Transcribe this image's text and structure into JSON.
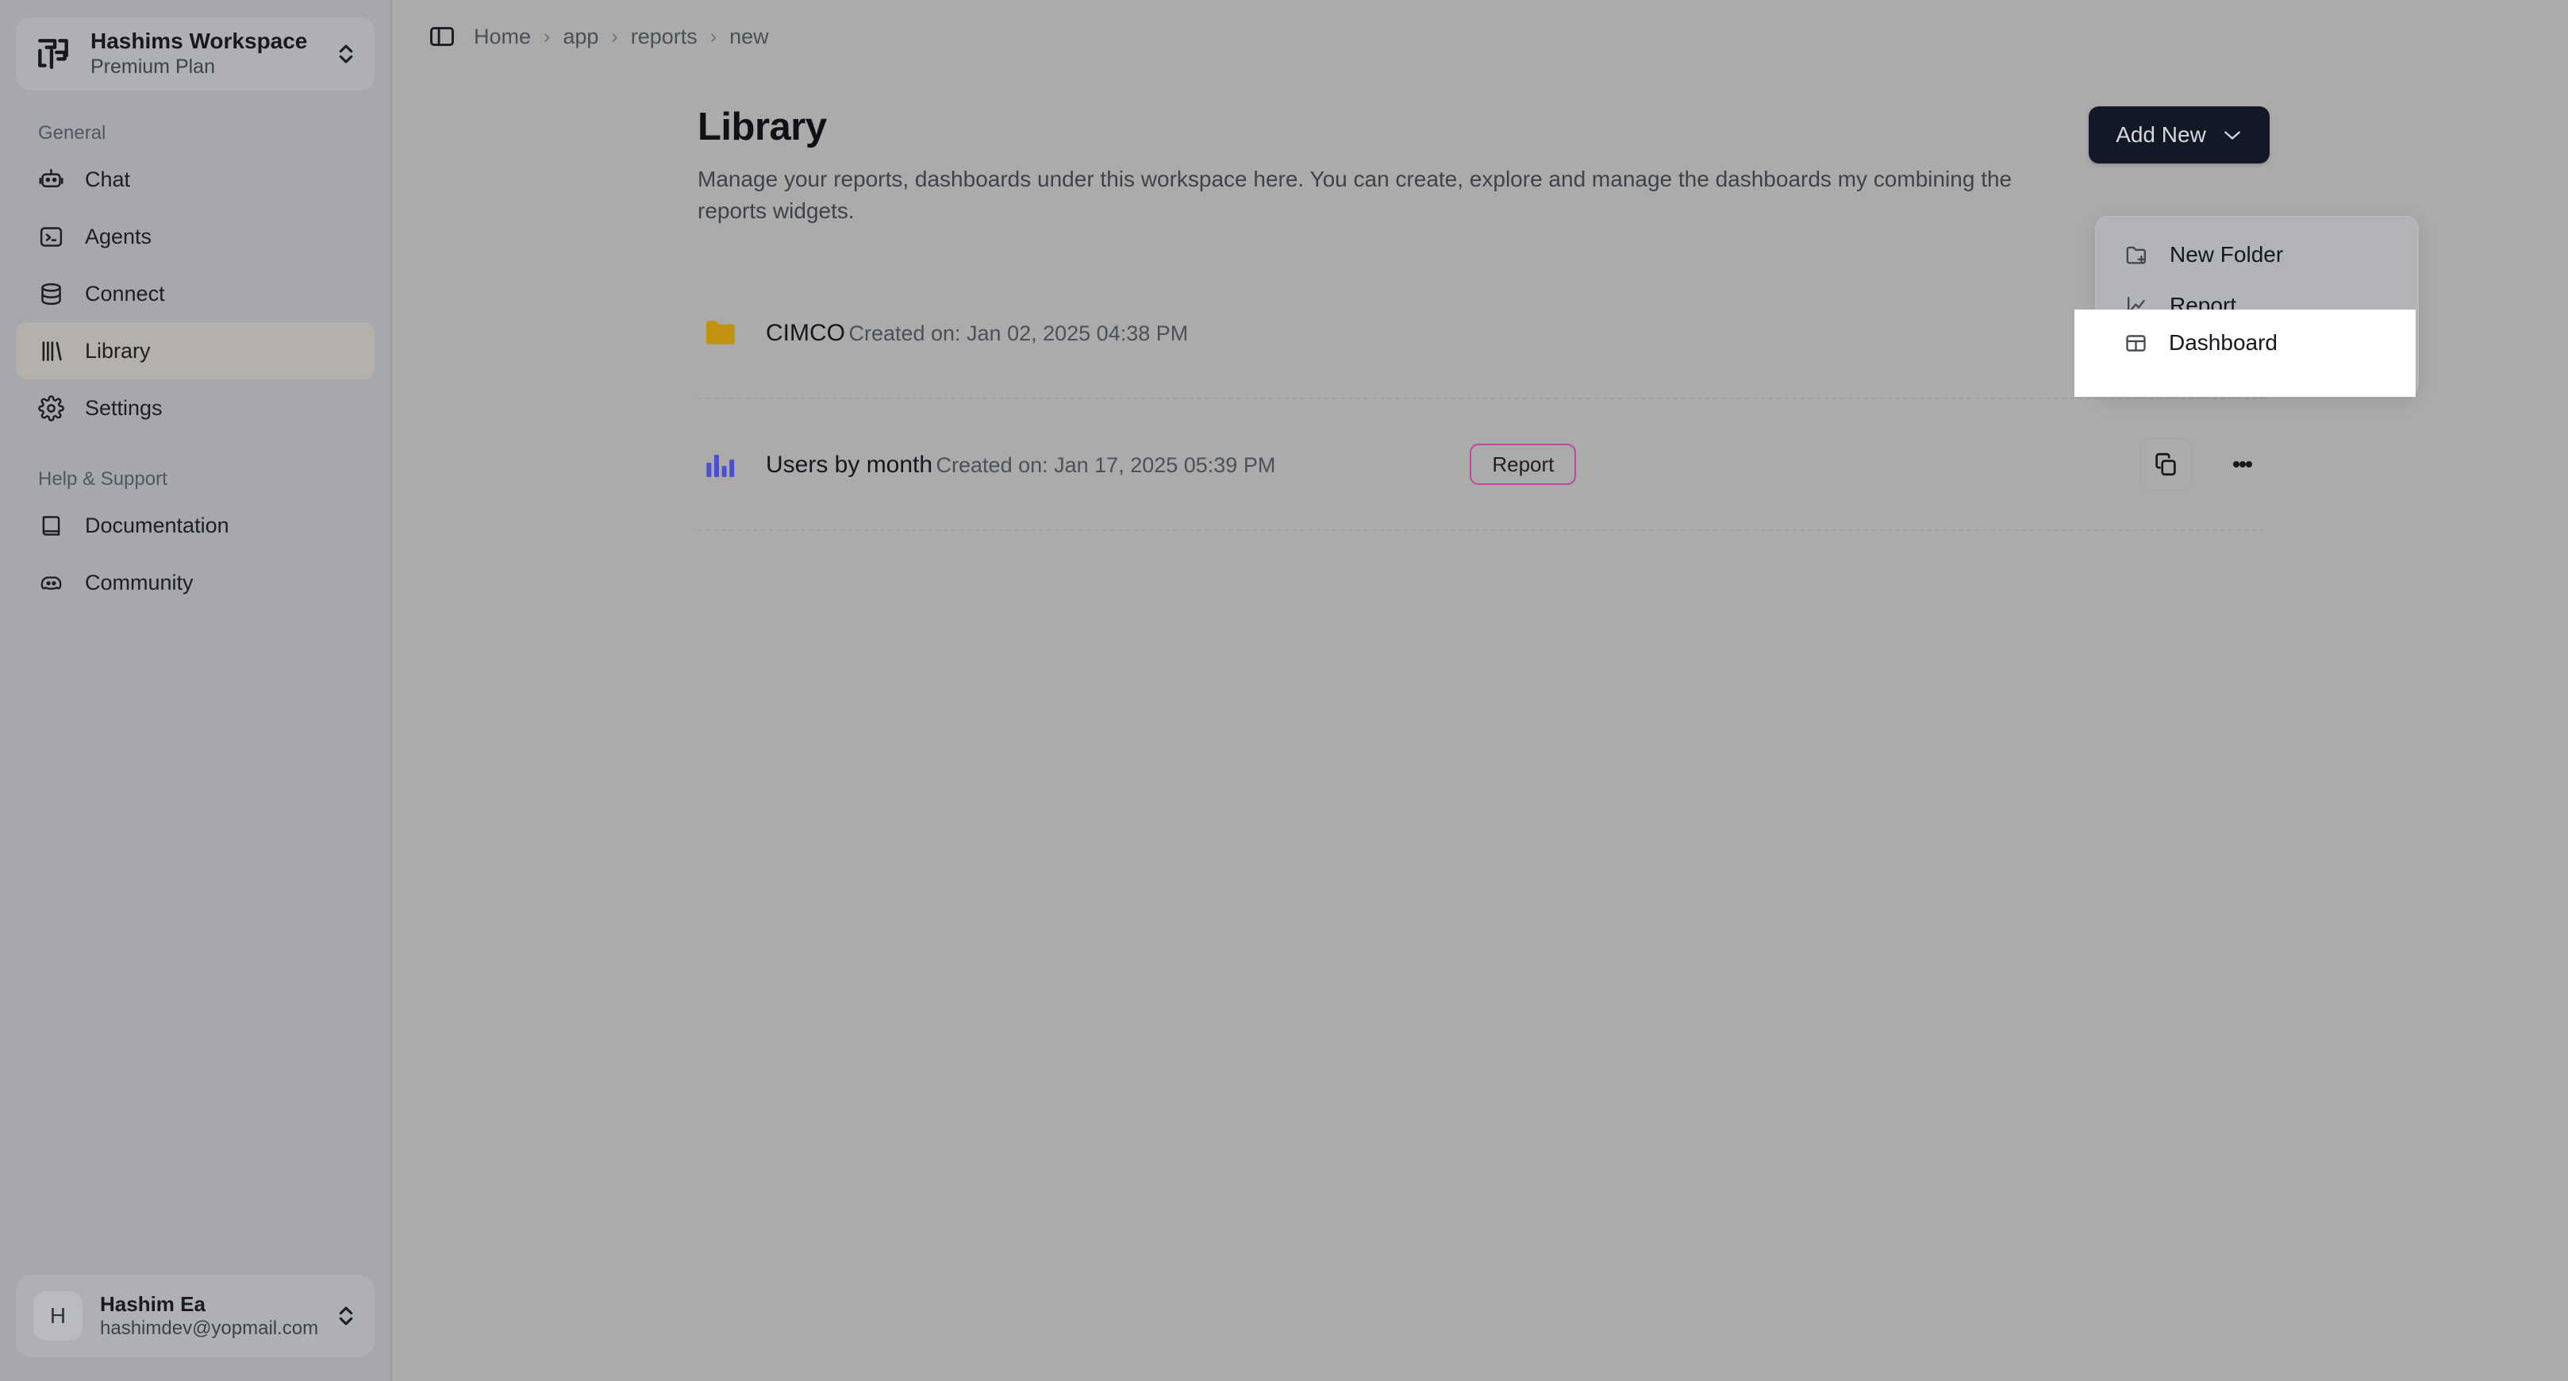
{
  "workspace": {
    "logo_icon": "workspace-logo-icon",
    "name": "Hashims Workspace",
    "plan": "Premium Plan",
    "switcher_icon": "chevron-up-down-icon"
  },
  "sidebar": {
    "sections": [
      {
        "label": "General",
        "items": [
          {
            "label": "Chat",
            "icon": "bot-icon",
            "active": false
          },
          {
            "label": "Agents",
            "icon": "terminal-square-icon",
            "active": false
          },
          {
            "label": "Connect",
            "icon": "database-icon",
            "active": false
          },
          {
            "label": "Library",
            "icon": "library-icon",
            "active": true
          },
          {
            "label": "Settings",
            "icon": "gear-icon",
            "active": false
          }
        ]
      },
      {
        "label": "Help & Support",
        "items": [
          {
            "label": "Documentation",
            "icon": "book-icon",
            "active": false
          },
          {
            "label": "Community",
            "icon": "discord-icon",
            "active": false
          }
        ]
      }
    ]
  },
  "user": {
    "initial": "H",
    "name": "Hashim Ea",
    "email": "hashimdev@yopmail.com",
    "switcher_icon": "chevron-up-down-icon"
  },
  "topbar": {
    "toggle_icon": "panel-left-icon",
    "breadcrumbs": [
      "Home",
      "app",
      "reports",
      "new"
    ],
    "separator": "›"
  },
  "page": {
    "title": "Library",
    "description": "Manage your reports, dashboards under this workspace here. You can create, explore and manage the dashboards my combining the reports widgets."
  },
  "add_new": {
    "label": "Add New",
    "chevron_icon": "chevron-down-icon",
    "menu": [
      {
        "label": "New Folder",
        "icon": "folder-plus-icon",
        "highlighted": false
      },
      {
        "label": "Report",
        "icon": "line-chart-icon",
        "highlighted": false
      },
      {
        "label": "Dashboard",
        "icon": "table-icon",
        "highlighted": true
      }
    ]
  },
  "list": {
    "rows": [
      {
        "icon": "folder-icon",
        "name": "CIMCO",
        "meta": "Created on: Jan 02, 2025 04:38 PM",
        "badge": "",
        "has_actions": false
      },
      {
        "icon": "bar-chart-icon",
        "name": "Users by month",
        "meta": "Created on: Jan 17, 2025 05:39 PM",
        "badge": "Report",
        "has_actions": true
      }
    ],
    "actions": {
      "copy_icon": "copy-icon",
      "more_icon": "more-vertical-icon"
    }
  },
  "colors": {
    "scrim": "#ababab",
    "sidebar_bg": "#a6a8ad",
    "button_dark": "#121826",
    "badge_border": "#c0479f",
    "folder_amber": "#c29310",
    "chart_indigo": "#4c4fd4",
    "highlight_white": "#ffffff"
  }
}
